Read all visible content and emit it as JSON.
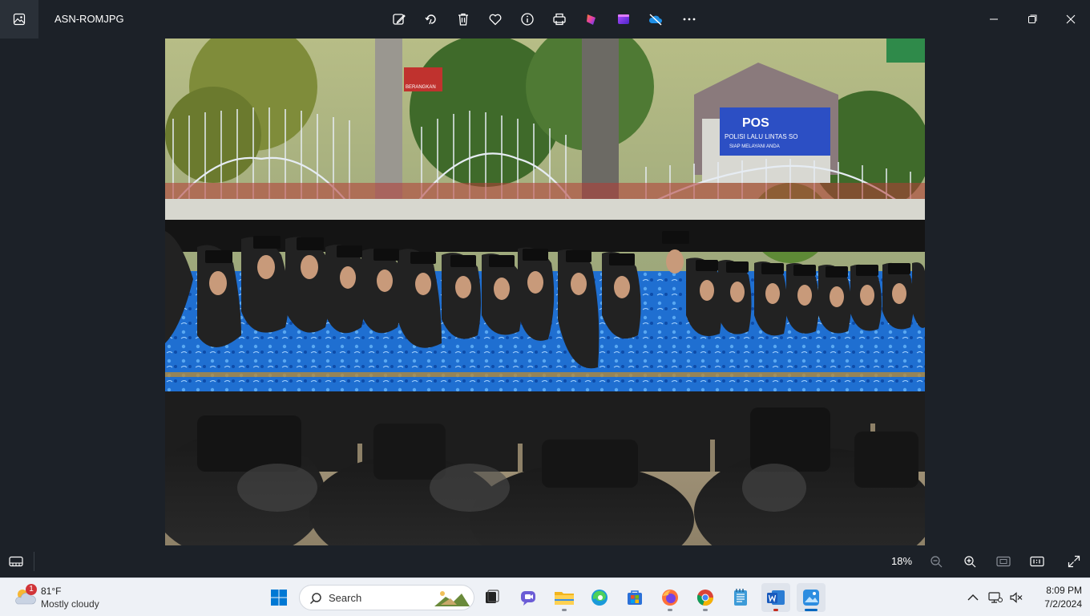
{
  "titlebar": {
    "filename": "ASN-ROMJPG",
    "app_icon": "photos-app-icon",
    "toolbar": [
      {
        "name": "edit-image-icon"
      },
      {
        "name": "rotate-icon"
      },
      {
        "name": "delete-icon"
      },
      {
        "name": "favorite-icon"
      },
      {
        "name": "info-icon"
      },
      {
        "name": "print-icon"
      },
      {
        "name": "clipchamp-icon"
      },
      {
        "name": "designer-icon"
      },
      {
        "name": "onedrive-off-icon"
      },
      {
        "name": "more-icon"
      }
    ],
    "window": [
      "minimize-icon",
      "maximize-icon",
      "close-icon"
    ]
  },
  "photo": {
    "sign_top": "POS",
    "sign_sub": "POLISI LALU LINTAS SO",
    "sign_sub2": "SIAP MELAYANI ANDA",
    "red_sign": "BERANGKAN"
  },
  "bottombar": {
    "zoom": "18%"
  },
  "taskbar": {
    "weather_temp": "81°F",
    "weather_cond": "Mostly cloudy",
    "weather_badge": "1",
    "search_label": "Search",
    "time": "8:09 PM",
    "date": "7/2/2024"
  },
  "colors": {
    "background": "#1c2128",
    "taskbar": "#eef1f6",
    "accent": "#0067c0",
    "uniform_blue": "#1f6fd1"
  }
}
